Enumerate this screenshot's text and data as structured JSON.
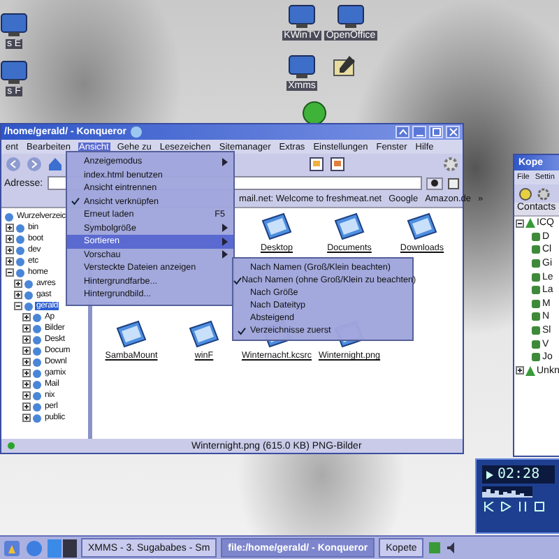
{
  "desktop_icons": [
    {
      "label": "s E"
    },
    {
      "label": "s F"
    },
    {
      "label": "KWinTV"
    },
    {
      "label": "OpenOffice"
    },
    {
      "label": "Xmms"
    }
  ],
  "konqueror": {
    "title": "/home/gerald/ - Konqueror",
    "menu": [
      {
        "label": "ent",
        "selected": false
      },
      {
        "label": "Bearbeiten",
        "selected": false
      },
      {
        "label": "Ansicht",
        "selected": true
      },
      {
        "label": "Gehe zu",
        "selected": false
      },
      {
        "label": "Lesezeichen",
        "selected": false
      },
      {
        "label": "Sitemanager",
        "selected": false
      },
      {
        "label": "Extras",
        "selected": false
      },
      {
        "label": "Einstellungen",
        "selected": false
      },
      {
        "label": "Fenster",
        "selected": false
      },
      {
        "label": "Hilfe",
        "selected": false
      }
    ],
    "address_label": "Adresse:",
    "bookmarks": [
      "mail.net: Welcome to freshmeat.net",
      "Google",
      "Amazon.de",
      "»"
    ],
    "tree": [
      {
        "label": "Wurzelverzeic",
        "selected": false,
        "children": [
          {
            "label": "bin",
            "expanded": false,
            "selected": false
          },
          {
            "label": "boot",
            "expanded": false,
            "selected": false
          },
          {
            "label": "dev",
            "expanded": false,
            "selected": false
          },
          {
            "label": "etc",
            "expanded": false,
            "selected": false
          },
          {
            "label": "home",
            "expanded": true,
            "selected": false,
            "children": [
              {
                "label": "avres",
                "expanded": false,
                "selected": false
              },
              {
                "label": "gast",
                "expanded": false,
                "selected": false
              },
              {
                "label": "gerald",
                "expanded": true,
                "selected": true,
                "children": [
                  {
                    "label": "Ap",
                    "expanded": false,
                    "selected": false
                  },
                  {
                    "label": "Bilder",
                    "expanded": false,
                    "selected": false
                  },
                  {
                    "label": "Deskt",
                    "expanded": false,
                    "selected": false
                  },
                  {
                    "label": "Docum",
                    "expanded": false,
                    "selected": false
                  },
                  {
                    "label": "Downl",
                    "expanded": false,
                    "selected": false
                  },
                  {
                    "label": "gamix",
                    "expanded": false,
                    "selected": false
                  },
                  {
                    "label": "Mail",
                    "expanded": false,
                    "selected": false
                  },
                  {
                    "label": "nix",
                    "expanded": false,
                    "selected": false
                  },
                  {
                    "label": "perl",
                    "expanded": false,
                    "selected": false
                  },
                  {
                    "label": "public",
                    "expanded": false,
                    "selected": false
                  }
                ]
              }
            ]
          }
        ]
      }
    ],
    "files": [
      {
        "label": "Desktop",
        "selected": false
      },
      {
        "label": "Documents",
        "selected": false
      },
      {
        "label": "Downloads",
        "selected": false
      },
      {
        "label": "SambaMount",
        "selected": false
      },
      {
        "label": "winF",
        "selected": false
      },
      {
        "label": "Winternacht.kcsrc",
        "selected": false
      },
      {
        "label": "Winternight.png",
        "selected": false
      }
    ],
    "status": "Winternight.png (615.0 KB)  PNG-Bilder"
  },
  "view_menu": [
    {
      "label": "Anzeigemodus",
      "kind": "submenu",
      "selected": false
    },
    {
      "label": "index.html benutzen",
      "kind": "action",
      "selected": false
    },
    {
      "label": "Ansicht eintrennen",
      "kind": "action",
      "selected": false
    },
    {
      "label": "Ansicht verknüpfen",
      "kind": "toggle",
      "checked": true,
      "selected": false
    },
    {
      "label": "Erneut laden",
      "kind": "action",
      "shortcut": "F5",
      "selected": false
    },
    {
      "label": "Symbolgröße",
      "kind": "submenu",
      "selected": false
    },
    {
      "label": "Sortieren",
      "kind": "submenu",
      "selected": true
    },
    {
      "label": "Vorschau",
      "kind": "submenu",
      "selected": false
    },
    {
      "label": "Versteckte Dateien anzeigen",
      "kind": "action",
      "selected": false
    },
    {
      "label": "Hintergrundfarbe...",
      "kind": "action",
      "selected": false
    },
    {
      "label": "Hintergrundbild...",
      "kind": "action",
      "selected": false
    }
  ],
  "sort_menu": [
    {
      "label": "Nach Namen (Groß/Klein beachten)",
      "checked": false,
      "selected": false
    },
    {
      "label": "Nach Namen (ohne Groß/Klein zu beachten)",
      "checked": true,
      "selected": false
    },
    {
      "label": "Nach Größe",
      "checked": false,
      "selected": false
    },
    {
      "label": "Nach Dateityp",
      "checked": false,
      "selected": false
    },
    {
      "label": "Absteigend",
      "checked": false,
      "selected": false
    },
    {
      "label": "Verzeichnisse zuerst",
      "checked": true,
      "selected": false
    }
  ],
  "kopete": {
    "title": "Kope",
    "menu": [
      "File",
      "Settin"
    ],
    "header": "Contacts",
    "groups": [
      {
        "label": "ICQ",
        "expanded": true,
        "children": [
          "D",
          "Cl",
          "Gi",
          "Le",
          "La",
          "M",
          "N",
          "Sl",
          "V",
          "Jo"
        ]
      },
      {
        "label": "Unkn",
        "expanded": false
      }
    ]
  },
  "xmms": {
    "time": "02:28"
  },
  "taskbar": {
    "tasks": [
      {
        "label": "XMMS - 3. Sugababes - Sm",
        "selected": false
      },
      {
        "label": "file:/home/gerald/ - Konqueror",
        "selected": true
      },
      {
        "label": "Kopete",
        "selected": false
      }
    ]
  }
}
